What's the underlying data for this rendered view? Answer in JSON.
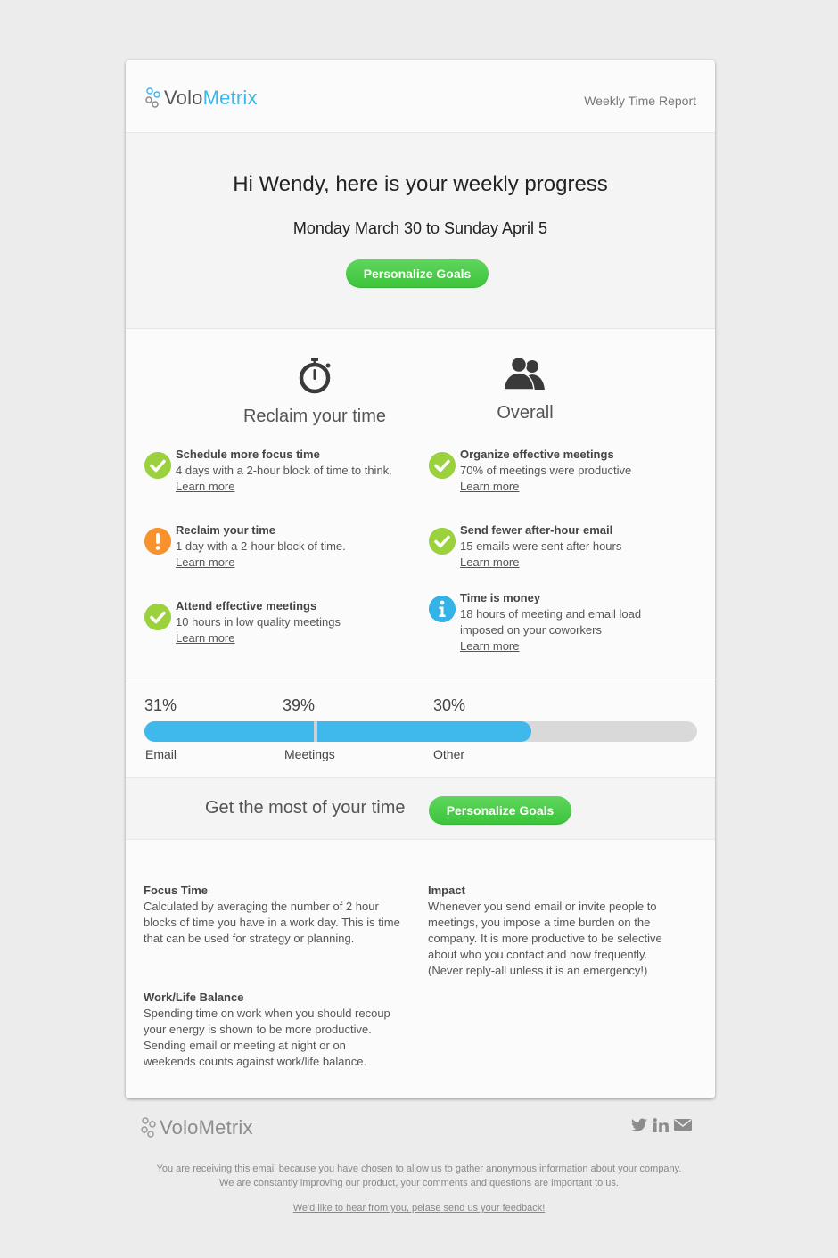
{
  "brand": {
    "name_part1": "Volo",
    "name_part2": "Metrix",
    "accent": "#3bb8e8"
  },
  "header": {
    "report_label": "Weekly Time Report"
  },
  "hero": {
    "title": "Hi Wendy, here is your weekly progress",
    "dates": "Monday March 30 to Sunday April 5",
    "button_label": "Personalize Goals"
  },
  "columns": {
    "left": {
      "title": "Reclaim your time",
      "icon": "stopwatch-icon"
    },
    "right": {
      "title": "Overall",
      "icon": "people-icon"
    }
  },
  "goals_left": [
    {
      "status": "check",
      "title": "Schedule more focus time",
      "desc": "4 days with a 2-hour block of time to think.",
      "link": "Learn more"
    },
    {
      "status": "warning",
      "title": "Reclaim your time",
      "desc": "1 day with a 2-hour block of time.",
      "link": "Learn more"
    },
    {
      "status": "check",
      "title": "Attend effective meetings",
      "desc": "10 hours in low quality meetings",
      "link": "Learn more"
    }
  ],
  "goals_right": [
    {
      "status": "check",
      "title": "Organize effective meetings",
      "desc": "70% of meetings were productive",
      "link": "Learn more"
    },
    {
      "status": "check",
      "title": "Send fewer after-hour email",
      "desc": "15 emails were sent after hours",
      "link": "Learn more"
    },
    {
      "status": "info",
      "title": "Time is money",
      "desc1": "18 hours of meeting and email load",
      "desc2": "imposed on your coworkers",
      "link": "Learn more"
    }
  ],
  "distribution": [
    {
      "pct_label": "31%",
      "label": "Email",
      "value": 31
    },
    {
      "pct_label": "39%",
      "label": "Meetings",
      "value": 39
    },
    {
      "pct_label": "30%",
      "label": "Other",
      "value": 30
    }
  ],
  "colors": {
    "email": "#3fb8ec",
    "meetings": "#3fb8ec",
    "other": "#d9d9d9",
    "check": "#9bd13d",
    "warning": "#f7922e",
    "info": "#34b3e6",
    "button": "#46c845"
  },
  "cta": {
    "text": "Get the most of your time",
    "button_label": "Personalize Goals"
  },
  "definitions": {
    "focus": {
      "title": "Focus Time",
      "lines": [
        "Calculated by averaging the number of 2 hour",
        "blocks of time you have in a work day. This is time",
        "that can be used for strategy or planning."
      ]
    },
    "impact": {
      "title": "Impact",
      "lines": [
        "Whenever you send email or invite people to",
        "meetings, you impose a time burden on the",
        "company. It is more productive to be selective",
        "about who you contact and how frequently.",
        "(Never reply-all unless it is an emergency!)"
      ]
    },
    "balance": {
      "title": "Work/Life Balance",
      "lines": [
        "Spending time on work when you should recoup",
        "your energy is shown to be more productive.",
        "Sending email or meeting at night or on",
        "weekends counts against work/life balance."
      ]
    }
  },
  "footer": {
    "social_icons": [
      "twitter-icon",
      "linkedin-icon",
      "mail-icon"
    ],
    "line1": "You are receiving this email because you have chosen to allow us to gather anonymous information about your company.",
    "line2": "We are constantly improving our product, your comments and questions are important to us.",
    "feedback_link": "We'd like to hear from you, pelase send us your feedback!"
  }
}
